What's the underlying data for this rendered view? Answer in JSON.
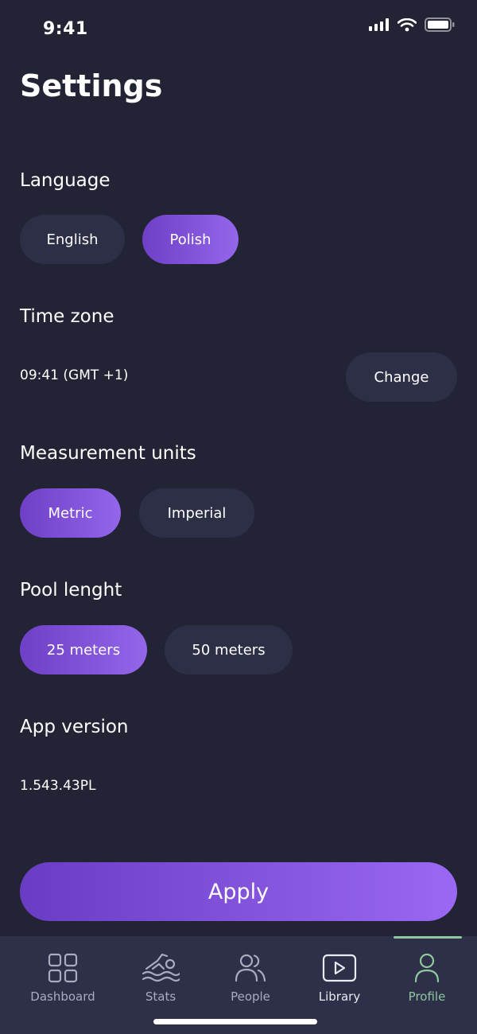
{
  "status_bar": {
    "time": "9:41"
  },
  "title": "Settings",
  "language": {
    "label": "Language",
    "options": [
      "English",
      "Polish"
    ],
    "selected": "Polish"
  },
  "time_zone": {
    "label": "Time zone",
    "value": "09:41 (GMT +1)",
    "change_label": "Change"
  },
  "measurement": {
    "label": "Measurement units",
    "options": [
      "Metric",
      "Imperial"
    ],
    "selected": "Metric"
  },
  "pool_length": {
    "label": "Pool lenght",
    "options": [
      "25 meters",
      "50 meters"
    ],
    "selected": "25 meters"
  },
  "app_version": {
    "label": "App version",
    "value": "1.543.43PL"
  },
  "apply_label": "Apply",
  "tabs": [
    {
      "label": "Dashboard",
      "icon": "grid-icon"
    },
    {
      "label": "Stats",
      "icon": "swimmer-icon"
    },
    {
      "label": "People",
      "icon": "people-icon"
    },
    {
      "label": "Library",
      "icon": "play-icon"
    },
    {
      "label": "Profile",
      "icon": "person-icon"
    }
  ],
  "active_tab": "Profile",
  "colors": {
    "background": "#222436",
    "accent": "#7b4fd8",
    "pill": "#2c2f45",
    "tab_bar": "#2d3048",
    "active_tab": "#8fc79f"
  }
}
